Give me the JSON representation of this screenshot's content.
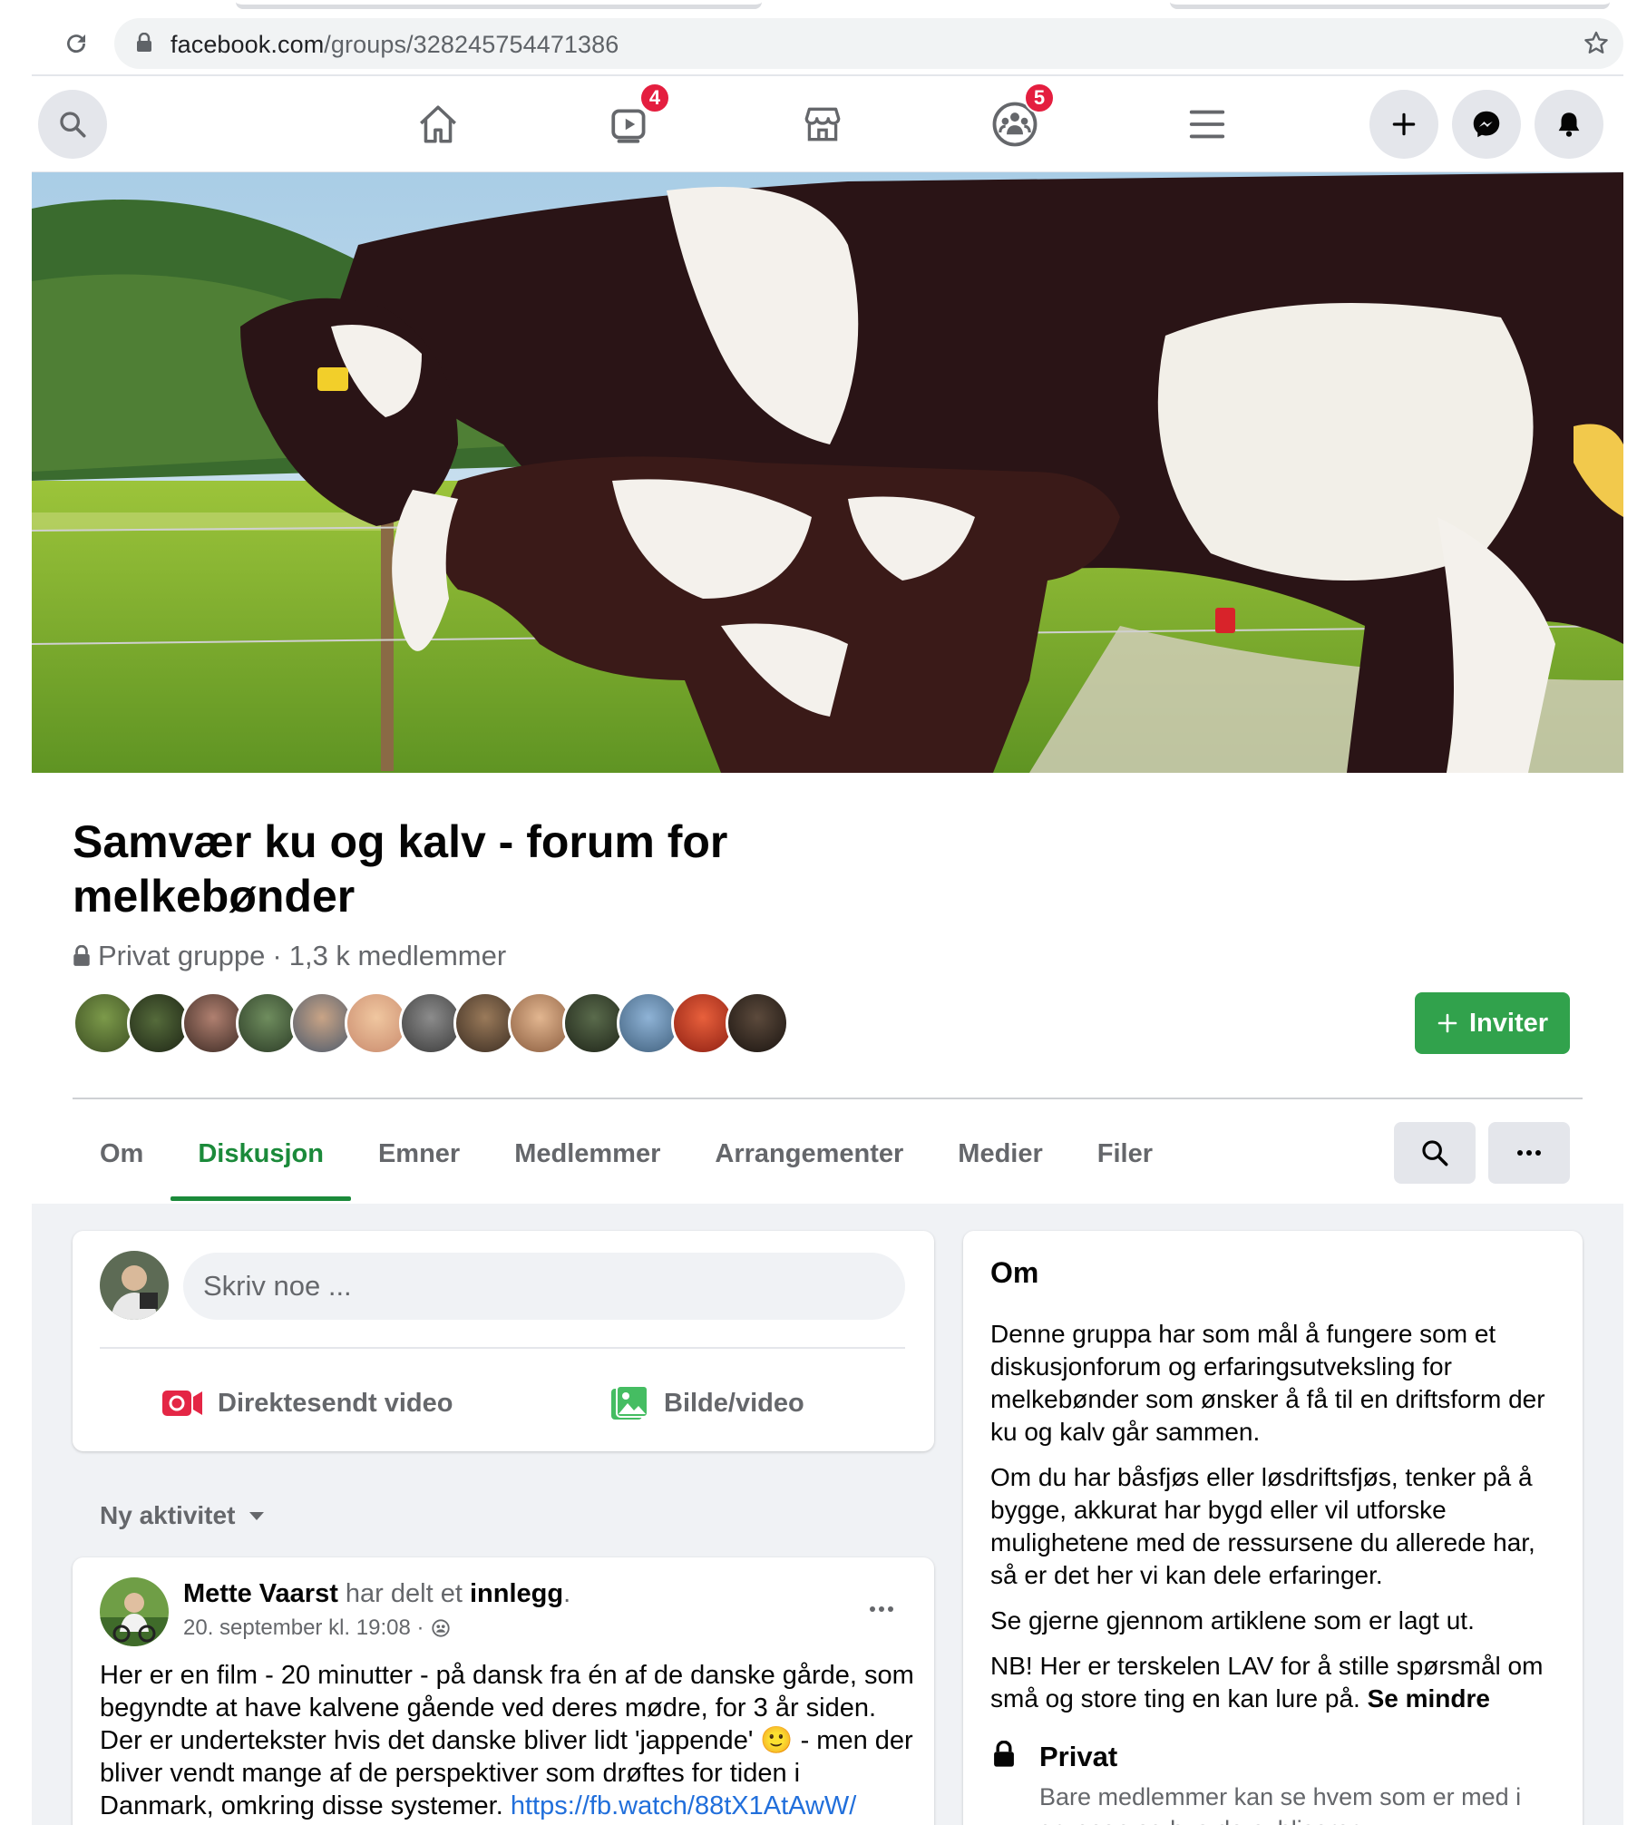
{
  "browser": {
    "url_domain": "facebook.com",
    "url_path": "/groups/328245754471386"
  },
  "nav": {
    "watch_badge": "4",
    "groups_badge": "5"
  },
  "group": {
    "title": "Samvær ku og kalv - forum for melkebønder",
    "privacy": "Privat gruppe",
    "members": "1,3 k medlemmer",
    "meta_separator": " · ",
    "invite_label": "Inviter",
    "avatar_count": 13
  },
  "tabs": [
    {
      "label": "Om"
    },
    {
      "label": "Diskusjon",
      "active": true
    },
    {
      "label": "Emner"
    },
    {
      "label": "Medlemmer"
    },
    {
      "label": "Arrangementer"
    },
    {
      "label": "Medier"
    },
    {
      "label": "Filer"
    }
  ],
  "composer": {
    "placeholder": "Skriv noe ...",
    "live_video_label": "Direktesendt video",
    "photo_video_label": "Bilde/video"
  },
  "feed": {
    "sort_label": "Ny aktivitet"
  },
  "post": {
    "author": "Mette Vaarst",
    "action_prefix": " har delt et ",
    "action_object": "innlegg",
    "action_suffix": ".",
    "timestamp": "20. september kl. 19:08 ·",
    "text": "Her er en film - 20 minutter - på dansk fra én af de danske gårde, som begyndte at have kalvene gående ved deres mødre, for 3 år siden. Der er undertekster hvis det danske bliver lidt 'jappende' 🙂 - men der bliver vendt mange af de perspektiver som drøftes for tiden i Danmark, omkring disse systemer.",
    "link": "https://fb.watch/88tX1AtAwW/"
  },
  "about": {
    "title": "Om",
    "paragraphs": [
      "Denne gruppa har som mål å fungere som et diskusjonforum og erfaringsutveksling for melkebønder som ønsker å få til en driftsform der ku og kalv går sammen.",
      "Om du har båsfjøs eller løsdriftsfjøs, tenker på å bygge, akkurat har bygd eller vil utforske mulighetene med de ressursene du allerede har, så er det her vi kan dele erfaringer.",
      "Se gjerne gjennom artiklene som er lagt ut."
    ],
    "last_paragraph": "NB! Her er terskelen LAV for å stille spørsmål om små og store ting en kan lure på.",
    "see_less": "Se mindre",
    "privacy_title": "Privat",
    "privacy_desc": "Bare medlemmer kan se hvem som er med i gruppen og hva de publiserer."
  },
  "colors": {
    "accent_green": "#1b8a3a",
    "invite_green": "#31a24c",
    "badge_red": "#e41e3f",
    "link_blue": "#216fdb"
  }
}
